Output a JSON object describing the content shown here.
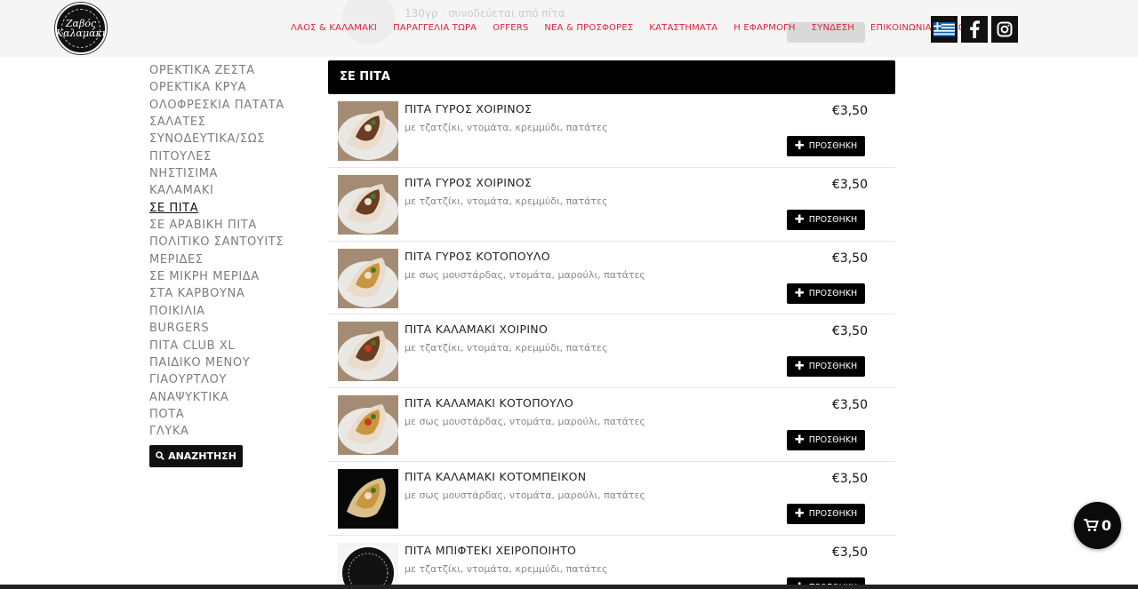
{
  "header": {
    "logo_text": "Ζαβός Καλαμάκι",
    "ghost_text": "130γρ · συνοδεύεται από πίτα",
    "nav": [
      "ΛΑΟΣ & ΚΑΛΑΜΑΚΙ",
      "ΠΑΡΑΓΓΕΛΙΑ ΤΩΡΑ",
      "OFFERS",
      "ΝΕΑ & ΠΡΟΣΦΟΡΕΣ",
      "ΚΑΤΑΣΤΗΜΑΤΑ",
      "Η ΕΦΑΡΜΟΓΗ",
      "ΣΥΝΔΕΣΗ",
      "ΕΠΙΚΟΙΝΩΝΙΑ"
    ],
    "cart_count": "0",
    "accent_color": "#e0213a"
  },
  "sidebar": {
    "items": [
      "ΟΡΕΚΤΙΚΑ ΖΕΣΤΑ",
      "ΟΡΕΚΤΙΚΑ ΚΡΥΑ",
      "ΟΛΟΦΡΕΣΚΙΑ ΠΑΤΑΤΑ",
      "ΣΑΛΑΤΕΣ",
      "ΣΥΝΟΔΕΥΤΙΚΑ/ΣΩΣ",
      "ΠΙΤΟΥΛΕΣ",
      "ΝΗΣΤΙΣΙΜΑ",
      "ΚΑΛΑΜΑΚΙ",
      "ΣΕ ΠΙΤΑ",
      "ΣΕ ΑΡΑΒΙΚΗ ΠΙΤΑ",
      "ΠΟΛΙΤΙΚΟ ΣΑΝΤΟΥΙΤΣ",
      "ΜΕΡΙΔΕΣ",
      "ΣΕ ΜΙΚΡΗ ΜΕΡΙΔΑ",
      "ΣΤΑ ΚΑΡΒΟΥΝΑ",
      "ΠΟΙΚΙΛΙΑ",
      "BURGERS",
      "ΠΙΤΑ CLUB XL",
      "ΠΑΙΔΙΚΟ ΜΕΝΟΥ",
      "ΓΙΑΟΥΡΤΛΟΥ",
      "ΑΝΑΨΥΚΤΙΚΑ",
      "ΠΟΤΑ",
      "ΓΛΥΚΑ"
    ],
    "active_item": "ΣΕ ΠΙΤΑ",
    "search_label": "ΑΝΑΖΗΤΗΣΗ"
  },
  "main": {
    "section_title": "ΣΕ ΠΙΤΑ",
    "add_label": "ΠΡΟΣΘΗΚΗ",
    "products": [
      {
        "name": "ΠΙΤΑ ΓΥΡΟΣ ΧΟΙΡΙΝΟΣ",
        "desc": "με τζατζίκι, ντομάτα, κρεμμύδι, πατάτες",
        "price": "€3,50",
        "image": "gyro-pita"
      },
      {
        "name": "ΠΙΤΑ ΓΥΡΟΣ ΧΟΙΡΙΝΟΣ",
        "desc": "με τζατζίκι, ντομάτα, κρεμμύδι, πατάτες",
        "price": "€3,50",
        "image": "gyro-pita"
      },
      {
        "name": "ΠΙΤΑ ΓΥΡΟΣ ΚΟΤΟΠΟΥΛΟ",
        "desc": "με σως μουστάρδας, ντομάτα, μαρούλι, πατάτες",
        "price": "€3,50",
        "image": "chicken-pita"
      },
      {
        "name": "ΠΙΤΑ ΚΑΛΑΜΑΚΙ ΧΟΙΡΙΝΟ",
        "desc": "με τζατζίκι, ντομάτα, κρεμμύδι, πατάτες",
        "price": "€3,50",
        "image": "souvlaki-pita"
      },
      {
        "name": "ΠΙΤΑ ΚΑΛΑΜΑΚΙ ΚΟΤΟΠΟΥΛΟ",
        "desc": "με σως μουστάρδας, ντομάτα, μαρούλι, πατάτες",
        "price": "€3,50",
        "image": "chicken-souvlaki-pita"
      },
      {
        "name": "ΠΙΤΑ ΚΑΛΑΜΑΚΙ ΚΟΤΟΜΠΕΙΚΟΝ",
        "desc": "με σως μουστάρδας, ντομάτα, μαρούλι, πατάτες",
        "price": "€3,50",
        "image": "chicken-bacon-pita"
      },
      {
        "name": "ΠΙΤΑ ΜΠΙΦΤΕΚΙ ΧΕΙΡΟΠΟΙΗΤΟ",
        "desc": "με τζατζίκι, ντομάτα, κρεμμύδι, πατάτες",
        "price": "€3,50",
        "image": "logo-placeholder"
      }
    ]
  },
  "cart_fab": {
    "count": "0"
  }
}
